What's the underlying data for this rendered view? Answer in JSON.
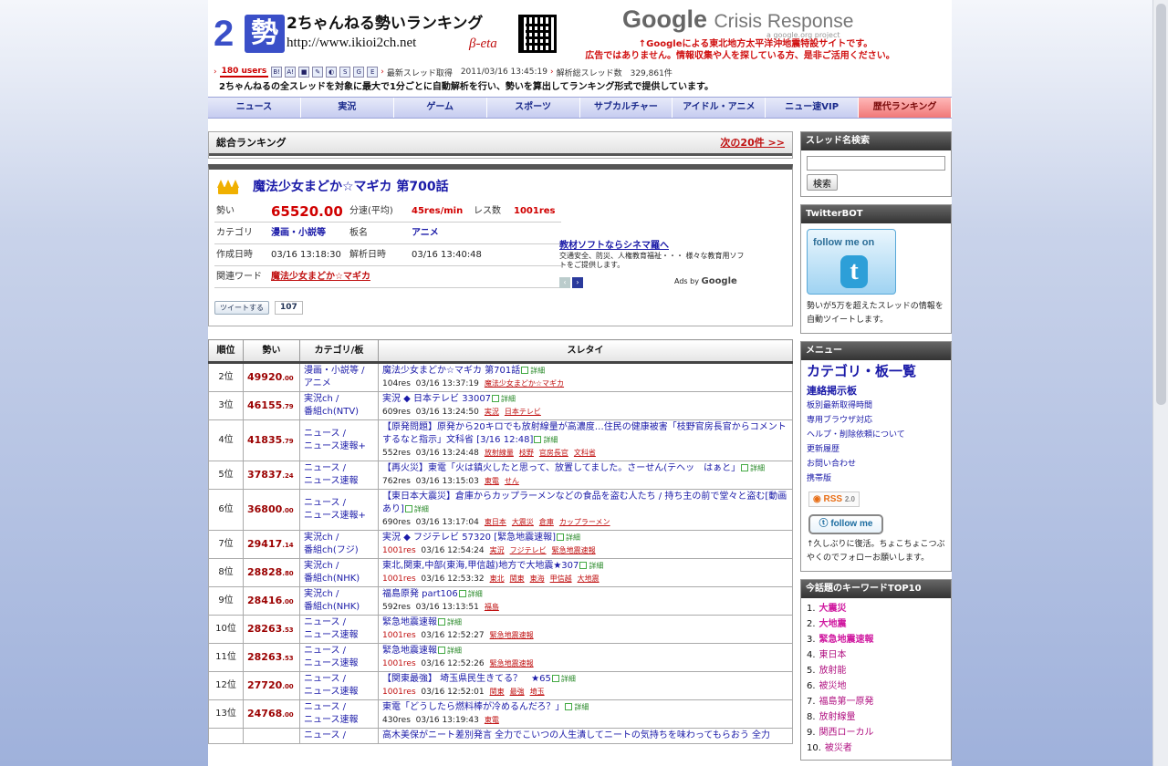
{
  "header": {
    "logo_two": "2",
    "logo_sei": "勢",
    "site_name": "2ちゃんねる勢いランキング",
    "site_url": "http://www.ikioi2ch.net",
    "beta": "β-eta",
    "gcr_google": "Google",
    "gcr_crisis": "Crisis Response",
    "gcr_sub": "a google.org project",
    "notice1": "↑Googleによる東北地方太平洋沖地震特設サイトです。",
    "notice2": "広告ではありません。情報収集や人を探している方、是非ご活用ください。",
    "users": "180 users",
    "share_icons": [
      "B!",
      "A!",
      "■",
      "✎",
      "◐",
      "S",
      "G",
      "E"
    ],
    "latest_label": "最新スレッド取得",
    "latest_time": "2011/03/16 13:45:19",
    "total_label": "解析総スレッド数",
    "total_count": "329,861件",
    "tagline": "2ちゃんねるの全スレッドを対象に最大で1分ごとに自動解析を行い、勢いを算出してランキング形式で提供しています。"
  },
  "nav": [
    "ニュース",
    "実況",
    "ゲーム",
    "スポーツ",
    "サブカルチャー",
    "アイドル・アニメ",
    "ニュー速VIP",
    "歴代ランキング"
  ],
  "overall": {
    "heading": "総合ランキング",
    "next": "次の20件 >>",
    "title": "魔法少女まどか☆マギカ 第700話",
    "ikioi_label": "勢い",
    "ikioi": "65520.00",
    "speed_label": "分速(平均)",
    "speed": "45res/min",
    "res_label": "レス数",
    "res": "1001res",
    "cat_label": "カテゴリ",
    "cat": "漫画・小説等",
    "board_label": "板名",
    "board": "アニメ",
    "created_label": "作成日時",
    "created": "03/16 13:18:30",
    "analyzed_label": "解析日時",
    "analyzed": "03/16 13:40:48",
    "kw_label": "関連ワード",
    "kw": "魔法少女まどか☆マギカ",
    "tweet": "ツイートする",
    "tweet_count": "107"
  },
  "ad": {
    "title": "教材ソフトならシネマ羅へ",
    "body": "交通安全、防災、人権教育福祉・・・ 様々な教育用ソフトをご提供します。",
    "by": "Ads by",
    "google": "Google"
  },
  "table": {
    "headers": [
      "順位",
      "勢い",
      "カテゴリ/板",
      "スレタイ"
    ],
    "rows": [
      {
        "rank": "2位",
        "int": "49920",
        "dec": ".00",
        "cat": "漫画・小説等 /",
        "board": "アニメ",
        "title": "魔法少女まどか☆マギカ 第701話",
        "res": "104res",
        "hot": false,
        "time": "03/16 13:37:19",
        "kws": [
          "魔法少女まどか☆マギカ"
        ]
      },
      {
        "rank": "3位",
        "int": "46155",
        "dec": ".79",
        "cat": "実況ch /",
        "board": "番組ch(NTV)",
        "title": "実況 ◆ 日本テレビ 33007",
        "res": "609res",
        "hot": false,
        "time": "03/16 13:24:50",
        "kws": [
          "実況",
          "日本テレビ"
        ]
      },
      {
        "rank": "4位",
        "int": "41835",
        "dec": ".79",
        "cat": "ニュース /",
        "board": "ニュース速報+",
        "title": "【原発問題】原発から20キロでも放射線量が高濃度…住民の健康被害「枝野官房長官からコメントするなと指示」文科省 [3/16 12:48]",
        "res": "552res",
        "hot": false,
        "time": "03/16 13:24:48",
        "kws": [
          "放射線量",
          "枝野",
          "官房長官",
          "文科省"
        ]
      },
      {
        "rank": "5位",
        "int": "37837",
        "dec": ".24",
        "cat": "ニュース /",
        "board": "ニュース速報",
        "title": "【再火災】東電「火は鎮火したと思って、放置してました。さーせん(テヘッ　はぁと」",
        "res": "762res",
        "hot": false,
        "time": "03/16 13:15:03",
        "kws": [
          "東電",
          "せん"
        ]
      },
      {
        "rank": "6位",
        "int": "36800",
        "dec": ".00",
        "cat": "ニュース /",
        "board": "ニュース速報+",
        "title": "【東日本大震災】倉庫からカップラーメンなどの食品を盗む人たち / 持ち主の前で堂々と盗む[動画あり]",
        "res": "690res",
        "hot": false,
        "time": "03/16 13:17:04",
        "kws": [
          "東日本",
          "大震災",
          "倉庫",
          "カップラーメン"
        ]
      },
      {
        "rank": "7位",
        "int": "29417",
        "dec": ".14",
        "cat": "実況ch /",
        "board": "番組ch(フジ)",
        "title": "実況 ◆ フジテレビ 57320 [緊急地震速報]",
        "res": "1001res",
        "hot": true,
        "time": "03/16 12:54:24",
        "kws": [
          "実況",
          "フジテレビ",
          "緊急地震速報"
        ]
      },
      {
        "rank": "8位",
        "int": "28828",
        "dec": ".80",
        "cat": "実況ch /",
        "board": "番組ch(NHK)",
        "title": "東北,関東,中部(東海,甲信越)地方で大地震★307",
        "res": "1001res",
        "hot": true,
        "time": "03/16 12:53:32",
        "kws": [
          "東北",
          "関東",
          "東海",
          "甲信越",
          "大地震"
        ]
      },
      {
        "rank": "9位",
        "int": "28416",
        "dec": ".00",
        "cat": "実況ch /",
        "board": "番組ch(NHK)",
        "title": "福島原発 part106",
        "res": "592res",
        "hot": false,
        "time": "03/16 13:13:51",
        "kws": [
          "福島"
        ]
      },
      {
        "rank": "10位",
        "int": "28263",
        "dec": ".53",
        "cat": "ニュース /",
        "board": "ニュース速報",
        "title": "緊急地震速報",
        "res": "1001res",
        "hot": true,
        "time": "03/16 12:52:27",
        "kws": [
          "緊急地震速報"
        ]
      },
      {
        "rank": "11位",
        "int": "28263",
        "dec": ".53",
        "cat": "ニュース /",
        "board": "ニュース速報",
        "title": "緊急地震速報",
        "res": "1001res",
        "hot": true,
        "time": "03/16 12:52:26",
        "kws": [
          "緊急地震速報"
        ]
      },
      {
        "rank": "12位",
        "int": "27720",
        "dec": ".00",
        "cat": "ニュース /",
        "board": "ニュース速報",
        "title": "【関東最強】 埼玉県民生きてる？　★65",
        "res": "1001res",
        "hot": true,
        "time": "03/16 12:52:01",
        "kws": [
          "関東",
          "最強",
          "埼玉"
        ]
      },
      {
        "rank": "13位",
        "int": "24768",
        "dec": ".00",
        "cat": "ニュース /",
        "board": "ニュース速報",
        "title": "東電「どうしたら燃料棒が冷めるんだろ？」",
        "res": "430res",
        "hot": false,
        "time": "03/16 13:19:43",
        "kws": [
          "東電"
        ]
      },
      {
        "rank": "",
        "int": "",
        "dec": "",
        "cat": "ニュース /",
        "board": "",
        "title": "高木美保がニート差別発言 全力でこいつの人生潰してニートの気持ちを味わってもらおう 全力",
        "res": "",
        "hot": false,
        "time": "",
        "kws": []
      }
    ],
    "detail": "詳細"
  },
  "sidebar": {
    "search_head": "スレッド名検索",
    "search_placeholder": "",
    "search_btn": "検索",
    "twitter_head": "TwitterBOT",
    "follow_text": "follow me on",
    "t_letter": "t",
    "twitter_desc": "勢いが5万を超えたスレッドの情報を自動ツイートします。",
    "menu_head": "メニュー",
    "menu_big": "カテゴリ・板一覧",
    "menu_mid": "連絡掲示板",
    "menu_items": [
      "板別最新取得時間",
      "専用ブラウザ対応",
      "ヘルプ・削除依頼について",
      "更新履歴",
      "お問い合わせ",
      "携帯版"
    ],
    "rss": "RSS",
    "rss_ver": "2.0",
    "followme": "follow me",
    "revive": "↑久しぶりに復活。ちょこちょこつぶやくのでフォローお願いします。",
    "kw_head": "今話題のキーワードTOP10",
    "keywords": [
      "大震災",
      "大地震",
      "緊急地震速報",
      "東日本",
      "放射能",
      "被災地",
      "福島第一原発",
      "放射線量",
      "関西ローカル",
      "被災者"
    ]
  }
}
